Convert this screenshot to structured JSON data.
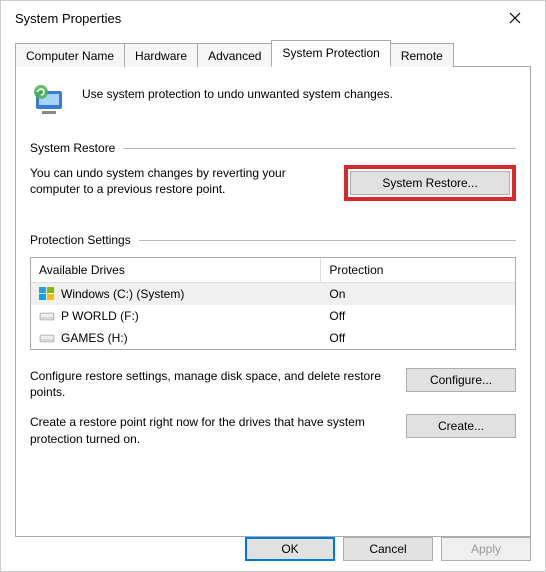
{
  "titlebar": {
    "title": "System Properties"
  },
  "tabs": {
    "items": [
      {
        "label": "Computer Name"
      },
      {
        "label": "Hardware"
      },
      {
        "label": "Advanced"
      },
      {
        "label": "System Protection"
      },
      {
        "label": "Remote"
      }
    ],
    "active_index": 3
  },
  "panel": {
    "intro_text": "Use system protection to undo unwanted system changes.",
    "restore": {
      "heading": "System Restore",
      "desc": "You can undo system changes by reverting your computer to a previous restore point.",
      "button_label": "System Restore..."
    },
    "protection": {
      "heading": "Protection Settings",
      "col_drive": "Available Drives",
      "col_prot": "Protection",
      "drives": [
        {
          "name": "Windows (C:) (System)",
          "status": "On",
          "type": "windows"
        },
        {
          "name": "P WORLD (F:)",
          "status": "Off",
          "type": "hdd"
        },
        {
          "name": "GAMES (H:)",
          "status": "Off",
          "type": "hdd"
        }
      ],
      "configure_desc": "Configure restore settings, manage disk space, and delete restore points.",
      "configure_label": "Configure...",
      "create_desc": "Create a restore point right now for the drives that have system protection turned on.",
      "create_label": "Create..."
    }
  },
  "buttons": {
    "ok": "OK",
    "cancel": "Cancel",
    "apply": "Apply"
  }
}
